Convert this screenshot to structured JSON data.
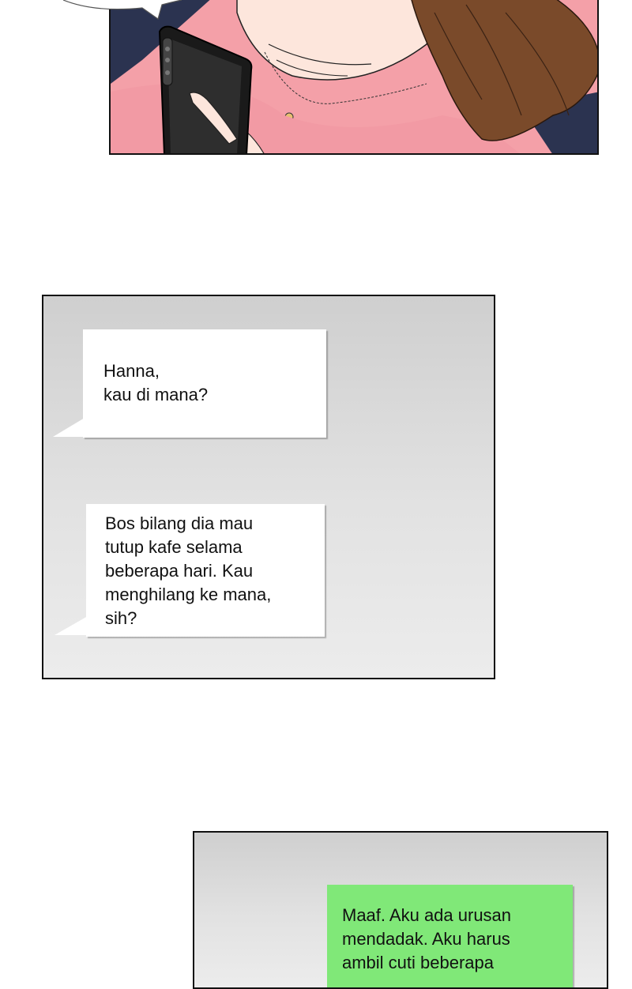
{
  "panel_top": {
    "colors": {
      "shirt": "#f4a0a8",
      "hair": "#7a4a2a",
      "phone": "#1a1a1a",
      "skin": "#fde6dc"
    }
  },
  "messages": [
    {
      "lines": [
        "Hanna,",
        "kau di mana?"
      ],
      "color": "#ffffff"
    },
    {
      "lines": [
        "Bos bilang dia mau",
        "tutup kafe selama",
        "beberapa hari. Kau",
        "menghilang ke mana,",
        "sih?"
      ],
      "color": "#ffffff"
    },
    {
      "lines": [
        "Maaf. Aku ada urusan",
        "mendadak. Aku harus",
        "ambil cuti beberapa"
      ],
      "color": "#80e878"
    }
  ]
}
